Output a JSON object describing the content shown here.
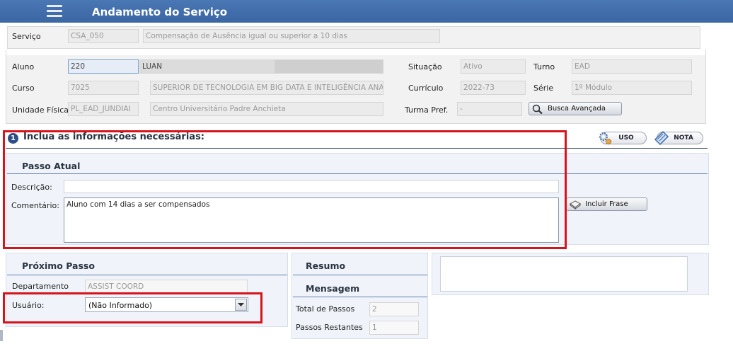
{
  "header": {
    "title": "Andamento do Serviço"
  },
  "service": {
    "label": "Serviço",
    "code": "CSA_050",
    "name": "Compensação de Ausência igual ou superior a 10 dias"
  },
  "student": {
    "aluno_label": "Aluno",
    "aluno_code": "220",
    "aluno_name": "LUAN",
    "curso_label": "Curso",
    "curso_code": "7025",
    "curso_name": "SUPERIOR DE TECNOLOGIA EM BIG DATA E INTELIGÊNCIA ANAL",
    "unidade_label": "Unidade Física",
    "unidade_code": "PL_EAD_JUNDIAI",
    "unidade_name": "Centro Universitário Padre Anchieta",
    "situacao_label": "Situação",
    "situacao_value": "Ativo",
    "curriculo_label": "Currículo",
    "curriculo_value": "2022-73",
    "turma_label": "Turma Pref.",
    "turma_value": "-",
    "turno_label": "Turno",
    "turno_value": "EAD",
    "serie_label": "Série",
    "serie_value": "1º Módulo",
    "busca_label": "Busca Avançada"
  },
  "step": {
    "badge": "1",
    "heading": "Inclua as informações necessárias:",
    "uso_label": "USO",
    "nota_label": "NOTA"
  },
  "passo_atual": {
    "title": "Passo Atual",
    "descricao_label": "Descrição:",
    "descricao_value": "",
    "comentario_label": "Comentário:",
    "comentario_value": "Aluno com 14 dias a ser compensados",
    "incluir_label": "Incluir Frase"
  },
  "proximo_passo": {
    "title": "Próximo Passo",
    "departamento_label": "Departamento",
    "departamento_value": "ASSIST COORD",
    "usuario_label": "Usuário:",
    "usuario_value": "(Não Informado)"
  },
  "resumo": {
    "title": "Resumo",
    "mensagem_title": "Mensagem",
    "total_label": "Total de Passos",
    "total_value": "2",
    "restantes_label": "Passos Restantes",
    "restantes_value": "1"
  },
  "colors": {
    "header": "#3f6eab",
    "highlight": "#d7141c",
    "section_line": "#5f7ea8"
  }
}
